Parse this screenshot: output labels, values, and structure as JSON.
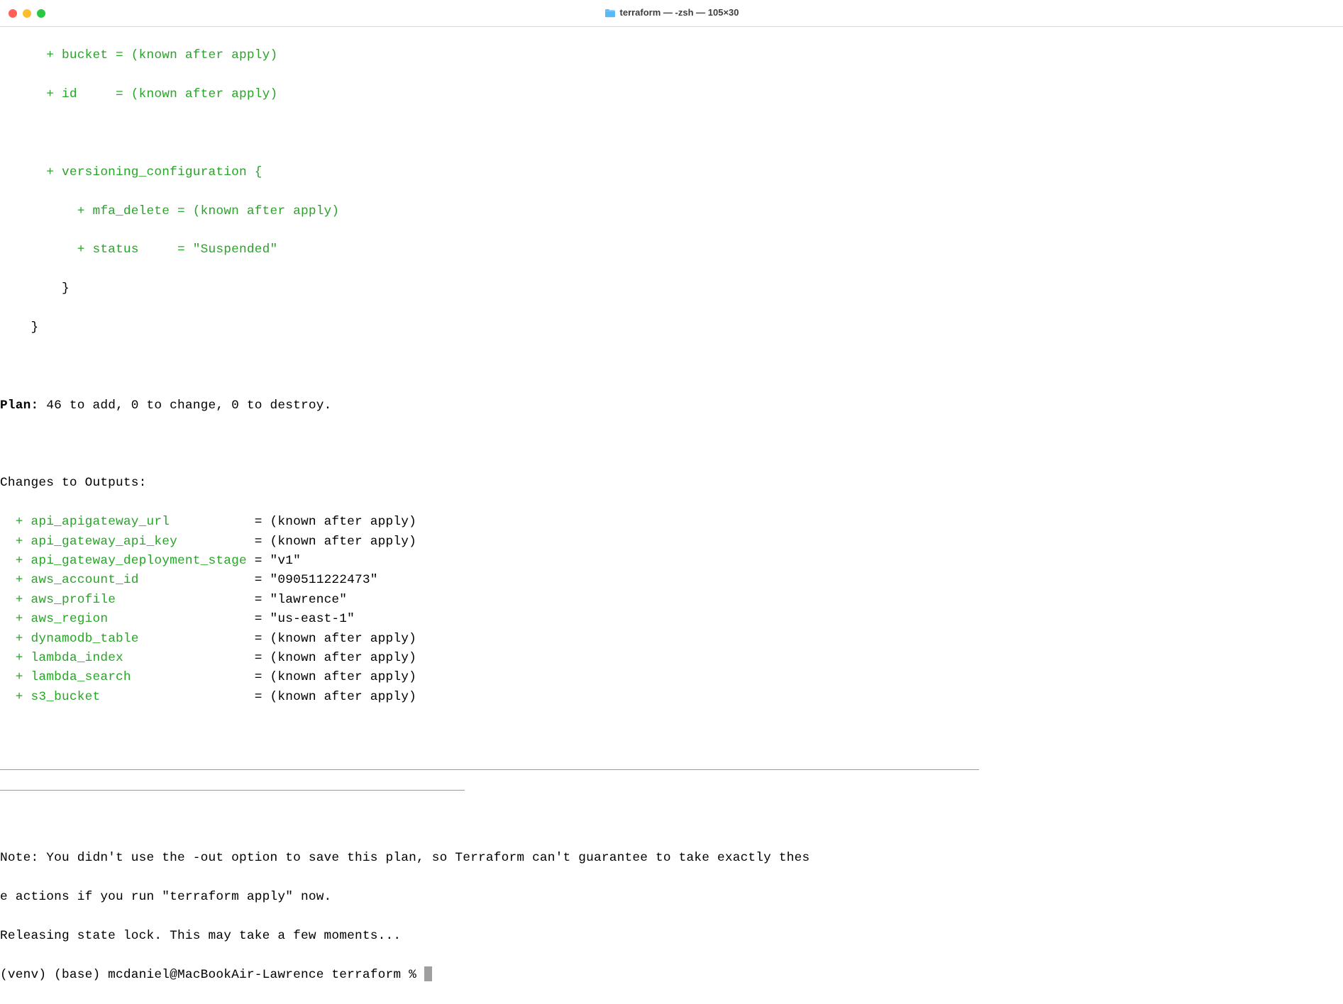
{
  "window": {
    "title": "terraform — -zsh — 105×30"
  },
  "block1": {
    "l1": "      + bucket = (known after apply)",
    "l2": "      + id     = (known after apply)",
    "l3": "",
    "l4": "      + versioning_configuration {",
    "l5": "          + mfa_delete = (known after apply)",
    "l6": "          + status     = \"Suspended\"",
    "l7": "        }",
    "l8": "    }"
  },
  "plan": {
    "label": "Plan:",
    "rest": " 46 to add, 0 to change, 0 to destroy."
  },
  "outputs": {
    "header": "Changes to Outputs:",
    "lines": [
      {
        "p": "  + ",
        "n": "api_apigateway_url          ",
        "v": " = (known after apply)"
      },
      {
        "p": "  + ",
        "n": "api_gateway_api_key         ",
        "v": " = (known after apply)"
      },
      {
        "p": "  + ",
        "n": "api_gateway_deployment_stage",
        "v": " = \"v1\""
      },
      {
        "p": "  + ",
        "n": "aws_account_id              ",
        "v": " = \"090511222473\""
      },
      {
        "p": "  + ",
        "n": "aws_profile                 ",
        "v": " = \"lawrence\""
      },
      {
        "p": "  + ",
        "n": "aws_region                  ",
        "v": " = \"us-east-1\""
      },
      {
        "p": "  + ",
        "n": "dynamodb_table              ",
        "v": " = (known after apply)"
      },
      {
        "p": "  + ",
        "n": "lambda_index                ",
        "v": " = (known after apply)"
      },
      {
        "p": "  + ",
        "n": "lambda_search               ",
        "v": " = (known after apply)"
      },
      {
        "p": "  + ",
        "n": "s3_bucket                   ",
        "v": " = (known after apply)"
      }
    ]
  },
  "note": {
    "l1": "Note: You didn't use the -out option to save this plan, so Terraform can't guarantee to take exactly thes",
    "l2": "e actions if you run \"terraform apply\" now."
  },
  "releasing": "Releasing state lock. This may take a few moments...",
  "prompt": "(venv) (base) mcdaniel@MacBookAir-Lawrence terraform % "
}
